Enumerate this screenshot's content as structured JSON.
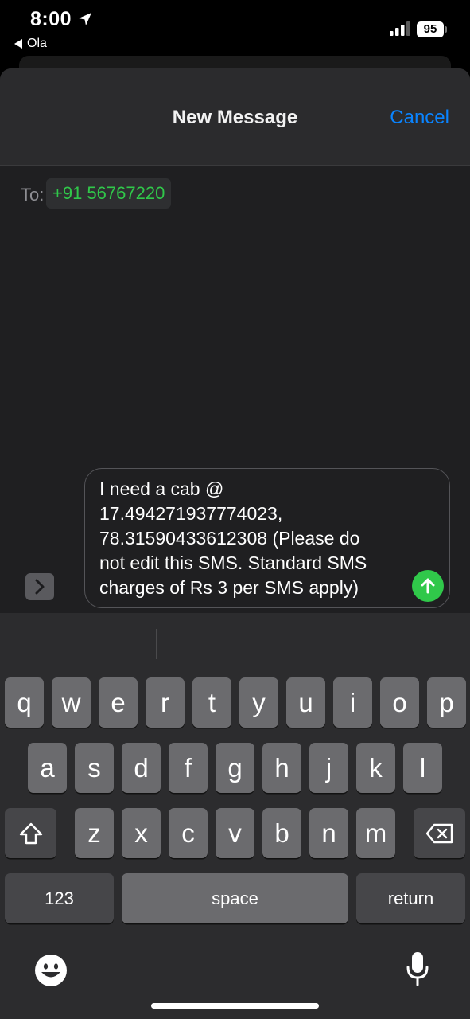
{
  "status_bar": {
    "time": "8:00",
    "back_app_label": "Ola",
    "battery_level": "95"
  },
  "header": {
    "title": "New Message",
    "cancel_label": "Cancel"
  },
  "recipient": {
    "to_label": "To:",
    "number": "+91 56767220"
  },
  "message": {
    "text": "I need a cab @\n17.494271937774023,\n78.31590433612308 (Please do\nnot edit this SMS. Standard SMS\ncharges of Rs 3 per SMS apply)"
  },
  "keyboard": {
    "row1": [
      "q",
      "w",
      "e",
      "r",
      "t",
      "y",
      "u",
      "i",
      "o",
      "p"
    ],
    "row2": [
      "a",
      "s",
      "d",
      "f",
      "g",
      "h",
      "j",
      "k",
      "l"
    ],
    "row3": [
      "z",
      "x",
      "c",
      "v",
      "b",
      "n",
      "m"
    ],
    "numbers_label": "123",
    "space_label": "space",
    "return_label": "return"
  },
  "colors": {
    "accent_blue": "#0a84ff",
    "send_green": "#30c84a",
    "recipient_green": "#30c84a"
  }
}
